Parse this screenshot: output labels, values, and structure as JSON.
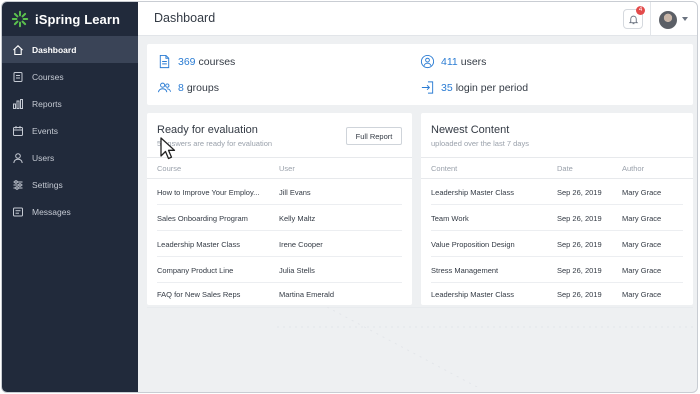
{
  "brand": {
    "name": "iSpring Learn"
  },
  "sidebar": {
    "items": [
      {
        "label": "Dashboard",
        "icon": "home-icon",
        "active": true
      },
      {
        "label": "Courses",
        "icon": "courses-icon"
      },
      {
        "label": "Reports",
        "icon": "reports-icon"
      },
      {
        "label": "Events",
        "icon": "calendar-icon"
      },
      {
        "label": "Users",
        "icon": "users-icon"
      },
      {
        "label": "Settings",
        "icon": "settings-icon"
      },
      {
        "label": "Messages",
        "icon": "messages-icon"
      }
    ]
  },
  "header": {
    "title": "Dashboard",
    "notifications_count": "4"
  },
  "stats": {
    "courses": {
      "value": "369",
      "label": "courses"
    },
    "users": {
      "value": "411",
      "label": "users"
    },
    "groups": {
      "value": "8",
      "label": "groups"
    },
    "logins": {
      "value": "35",
      "label": "login per period"
    }
  },
  "ready": {
    "title": "Ready for evaluation",
    "subtitle": "5 answers are ready for evaluation",
    "button": "Full Report",
    "columns": [
      "Course",
      "User"
    ],
    "rows": [
      [
        "How to Improve Your Employ...",
        "Jill Evans"
      ],
      [
        "Sales Onboarding Program",
        "Kelly Maltz"
      ],
      [
        "Leadership Master Class",
        "Irene Cooper"
      ],
      [
        "Company Product Line",
        "Julia Stells"
      ],
      [
        "FAQ for New Sales Reps",
        "Martina Emerald"
      ]
    ]
  },
  "newest": {
    "title": "Newest Content",
    "subtitle": "uploaded over the last 7 days",
    "columns": [
      "Content",
      "Date",
      "Author"
    ],
    "rows": [
      [
        "Leadership Master Class",
        "Sep 26, 2019",
        "Mary Grace"
      ],
      [
        "Team Work",
        "Sep 26, 2019",
        "Mary Grace"
      ],
      [
        "Value Proposition Design",
        "Sep 26, 2019",
        "Mary Grace"
      ],
      [
        "Stress Management",
        "Sep 26, 2019",
        "Mary Grace"
      ],
      [
        "Leadership Master Class",
        "Sep 26, 2019",
        "Mary Grace"
      ]
    ]
  },
  "colors": {
    "sidebar": "#212a3b",
    "accent": "#2b7cd3",
    "brand_green": "#5cc14e"
  }
}
